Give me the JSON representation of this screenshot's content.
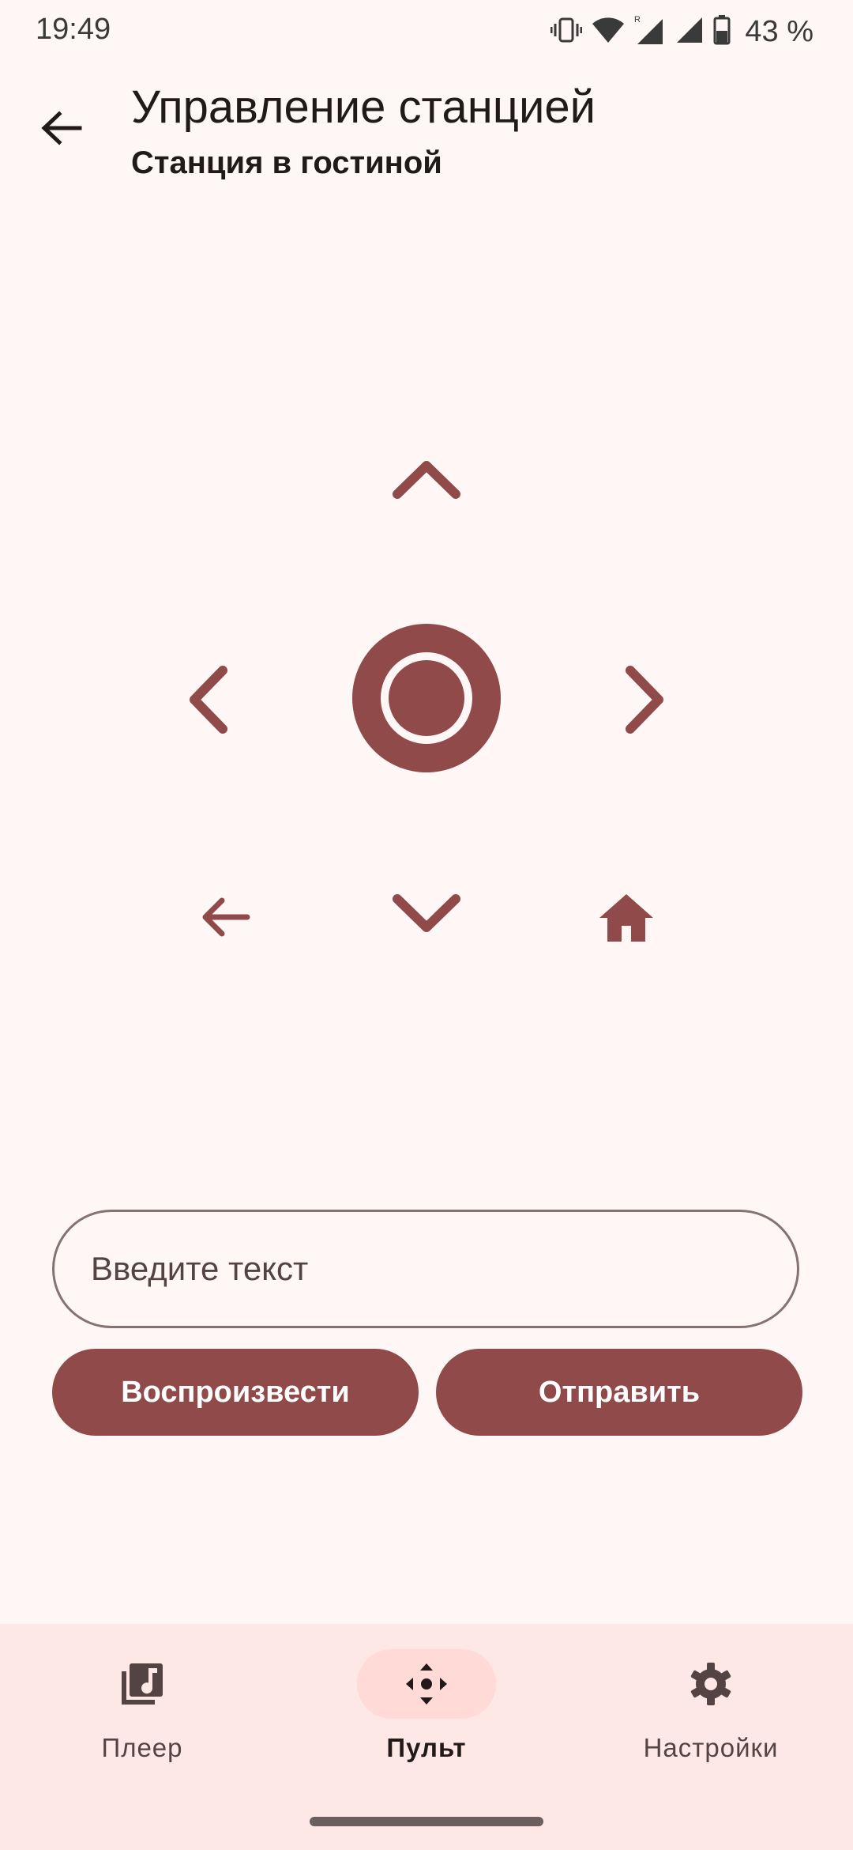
{
  "status_bar": {
    "time": "19:49",
    "battery_percent": "43 %",
    "icons": [
      "vibrate-icon",
      "wifi-icon",
      "signal-roaming-icon",
      "signal-icon",
      "battery-icon"
    ]
  },
  "header": {
    "title": "Управление станцией",
    "subtitle": "Станция в гостиной"
  },
  "remote": {
    "icons": [
      "chevron-up-icon",
      "chevron-left-icon",
      "ok-center-icon",
      "chevron-right-icon",
      "back-arrow-icon",
      "chevron-down-icon",
      "home-icon"
    ],
    "accent_color": "#904a4a"
  },
  "text_input": {
    "placeholder": "Введите текст",
    "value": ""
  },
  "actions": {
    "play_label": "Воспроизвести",
    "send_label": "Отправить"
  },
  "bottom_nav": {
    "items": [
      {
        "label": "Плеер",
        "icon": "music-library-icon",
        "active": false
      },
      {
        "label": "Пульт",
        "icon": "dpad-remote-icon",
        "active": true
      },
      {
        "label": "Настройки",
        "icon": "gear-icon",
        "active": false
      }
    ]
  }
}
